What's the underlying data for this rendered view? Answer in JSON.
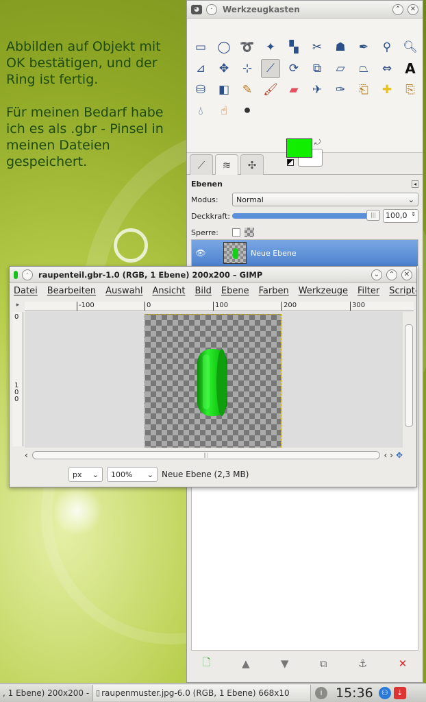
{
  "desktop": {
    "text": "Abbilden auf Objekt mit\nOK bestätigen, und der\nRing ist fertig.\n\nFür meinen Bedarf habe\nich es als .gbr - Pinsel in\nmeinen Dateien\ngespeichert."
  },
  "toolbox": {
    "title": "Werkzeugkasten",
    "fg_color": "#11ee00",
    "bg_color": "#ffffff",
    "layers": {
      "heading": "Ebenen",
      "mode_label": "Modus:",
      "mode_value": "Normal",
      "opacity_label": "Deckkraft:",
      "opacity_value": "100,0",
      "opacity_fraction": 1.0,
      "lock_label": "Sperre:",
      "layer_name": "Neue Ebene"
    }
  },
  "image_window": {
    "title": "raupenteil.gbr-1.0 (RGB, 1 Ebene) 200x200 – GIMP",
    "menu": [
      "Datei",
      "Bearbeiten",
      "Auswahl",
      "Ansicht",
      "Bild",
      "Ebene",
      "Farben",
      "Werkzeuge",
      "Filter",
      "Script-F"
    ],
    "ruler_h": [
      "-100",
      "0",
      "100",
      "200",
      "300"
    ],
    "ruler_v": [
      "0",
      "1",
      "0",
      "0"
    ],
    "unit": "px",
    "zoom": "100%",
    "status": "Neue Ebene (2,3 MB)"
  },
  "taskbar": {
    "task1": ", 1 Ebene) 200x200 -",
    "task2": "raupenmuster.jpg-6.0 (RGB, 1 Ebene) 668x10",
    "clock": "15:36"
  }
}
